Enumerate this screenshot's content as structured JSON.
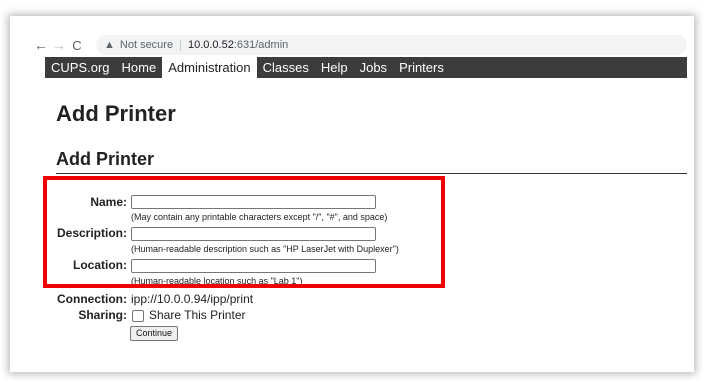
{
  "browser": {
    "back_icon": "←",
    "forward_icon": "→",
    "reload_icon": "C",
    "security_icon": "▲",
    "security_label": "Not secure",
    "separator": "|",
    "url_host": "10.0.0.52",
    "url_rest": ":631/admin"
  },
  "menubar": {
    "items": [
      {
        "label": "CUPS.org",
        "active": false
      },
      {
        "label": "Home",
        "active": false
      },
      {
        "label": "Administration",
        "active": true
      },
      {
        "label": "Classes",
        "active": false
      },
      {
        "label": "Help",
        "active": false
      },
      {
        "label": "Jobs",
        "active": false
      },
      {
        "label": "Printers",
        "active": false
      }
    ]
  },
  "page": {
    "title": "Add Printer",
    "subtitle": "Add Printer"
  },
  "form": {
    "name_label": "Name:",
    "name_value": "",
    "name_hint": "(May contain any printable characters except \"/\", \"#\", and space)",
    "description_label": "Description:",
    "description_value": "",
    "description_hint": "(Human-readable description such as \"HP LaserJet with Duplexer\")",
    "location_label": "Location:",
    "location_value": "",
    "location_hint": "(Human-readable location such as \"Lab 1\")",
    "connection_label": "Connection:",
    "connection_value": "ipp://10.0.0.94/ipp/print",
    "sharing_label": "Sharing:",
    "sharing_checked": false,
    "sharing_option": "Share This Printer",
    "continue_label": "Continue"
  },
  "colors": {
    "menubar_bg": "#3c3c3c",
    "highlight_border": "#ee0000"
  }
}
